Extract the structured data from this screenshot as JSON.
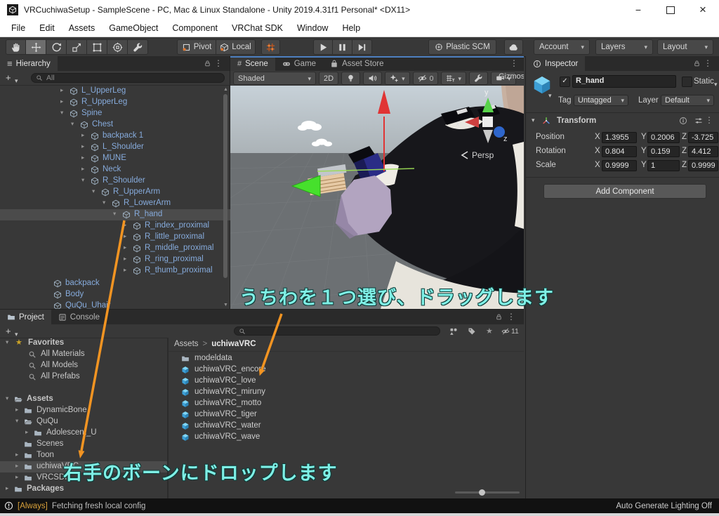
{
  "window": {
    "title": "VRCuchiwaSetup - SampleScene - PC, Mac & Linux Standalone - Unity 2019.4.31f1 Personal* <DX11>"
  },
  "menu": {
    "items": [
      "File",
      "Edit",
      "Assets",
      "GameObject",
      "Component",
      "VRChat SDK",
      "Window",
      "Help"
    ]
  },
  "toolbar": {
    "pivot": "Pivot",
    "local": "Local",
    "plastic": "Plastic SCM",
    "account": "Account",
    "layers": "Layers",
    "layout": "Layout"
  },
  "hierarchy": {
    "tab": "Hierarchy",
    "create": "+",
    "search": "All",
    "items": [
      {
        "label": "L_UpperLeg"
      },
      {
        "label": "R_UpperLeg"
      },
      {
        "label": "Spine"
      },
      {
        "label": "Chest"
      },
      {
        "label": "backpack 1"
      },
      {
        "label": "L_Shoulder"
      },
      {
        "label": "MUNE"
      },
      {
        "label": "Neck"
      },
      {
        "label": "R_Shoulder"
      },
      {
        "label": "R_UpperArm"
      },
      {
        "label": "R_LowerArm"
      },
      {
        "label": "R_hand"
      },
      {
        "label": "R_index_proximal"
      },
      {
        "label": "R_little_proximal"
      },
      {
        "label": "R_middle_proximal"
      },
      {
        "label": "R_ring_proximal"
      },
      {
        "label": "R_thumb_proximal"
      },
      {
        "label": "backpack"
      },
      {
        "label": "Body"
      },
      {
        "label": "QuQu_Uhair"
      }
    ]
  },
  "scene": {
    "tabs": [
      "Scene",
      "Game",
      "Asset Store"
    ],
    "shading": "Shaded",
    "btn_2d": "2D",
    "hidden_count": "0",
    "gizmos": "Gizmos",
    "axis": {
      "x": "x",
      "y": "y",
      "z": "z"
    },
    "persp": "Persp"
  },
  "inspector": {
    "tab": "Inspector",
    "object_name": "R_hand",
    "static": "Static",
    "tag_label": "Tag",
    "tag": "Untagged",
    "layer_label": "Layer",
    "layer": "Default",
    "transform": {
      "title": "Transform",
      "axis": [
        "X",
        "Y",
        "Z"
      ],
      "rows": [
        {
          "label": "Position",
          "x": "1.3955",
          "y": "0.2006",
          "z": "-3.725"
        },
        {
          "label": "Rotation",
          "x": "0.804",
          "y": "0.159",
          "z": "4.412"
        },
        {
          "label": "Scale",
          "x": "0.9999",
          "y": "1",
          "z": "0.9999"
        }
      ]
    },
    "add_component": "Add Component"
  },
  "project": {
    "tabs": [
      "Project",
      "Console"
    ],
    "create": "+",
    "hidden_count": "11",
    "favorites": {
      "label": "Favorites",
      "items": [
        "All Materials",
        "All Models",
        "All Prefabs"
      ]
    },
    "tree": [
      {
        "label": "Assets"
      },
      {
        "label": "DynamicBone"
      },
      {
        "label": "QuQu"
      },
      {
        "label": "Adolescent_U"
      },
      {
        "label": "Scenes"
      },
      {
        "label": "Toon"
      },
      {
        "label": "uchiwaVRC"
      },
      {
        "label": "VRCSDK"
      },
      {
        "label": "Packages"
      }
    ],
    "breadcrumb": {
      "root": "Assets",
      "sep": ">",
      "current": "uchiwaVRC"
    },
    "assets": [
      {
        "name": "modeldata"
      },
      {
        "name": "uchiwaVRC_encore"
      },
      {
        "name": "uchiwaVRC_love"
      },
      {
        "name": "uchiwaVRC_miruny"
      },
      {
        "name": "uchiwaVRC_motto"
      },
      {
        "name": "uchiwaVRC_tiger"
      },
      {
        "name": "uchiwaVRC_water"
      },
      {
        "name": "uchiwaVRC_wave"
      }
    ]
  },
  "status": {
    "tag": "[Always]",
    "message": "Fetching fresh local config",
    "right": "Auto Generate Lighting Off"
  },
  "annotations": {
    "drag": "うちわを１つ選び、ドラッグします",
    "drop": "右手のボーンにドロップします",
    "accent_color": "#f29422",
    "text_color": "#7ff0e6"
  },
  "icons": {
    "hierarchy_item": "cube-outline",
    "prefab_asset": "cube-blue",
    "folder": "folder",
    "search": "magnifier",
    "favorites": "star",
    "lock": "padlock",
    "more": "kebab-vertical",
    "warning": "exclamation-circle",
    "cloud": "cloud",
    "scene_tab": "grid-hash",
    "game_tab": "gamepad",
    "asset_store_tab": "shopping-bag"
  }
}
